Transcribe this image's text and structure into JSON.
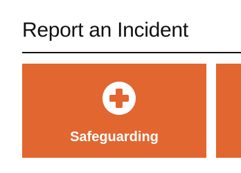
{
  "page": {
    "title": "Report an Incident"
  },
  "tiles": [
    {
      "label": "Safeguarding",
      "icon": "medical-cross-icon",
      "color": "#e2662f"
    }
  ],
  "colors": {
    "tile_background": "#e2662f",
    "tile_text": "#ffffff",
    "heading_text": "#111111"
  }
}
